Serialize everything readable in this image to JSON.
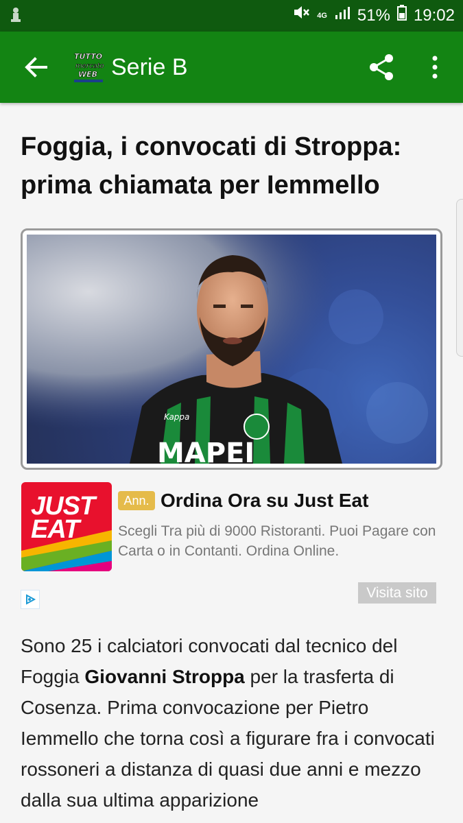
{
  "status_bar": {
    "network": "4G",
    "battery": "51%",
    "time": "19:02"
  },
  "app_bar": {
    "logo_text": [
      "TUTTO",
      "mercato",
      "WEB"
    ],
    "title": "Serie B"
  },
  "article": {
    "headline": "Foggia, i convocati di Stroppa: prima chiamata per Iemmello",
    "body": [
      {
        "text": "Sono 25 i calciatori convocati dal tecnico del Foggia ",
        "bold": false
      },
      {
        "text": "Giovanni Stroppa",
        "bold": true
      },
      {
        "text": " per la trasferta di Cosenza. Prima convocazione per Pietro Iemmello che torna così a figurare fra i convocati rossoneri a distanza di quasi due anni e mezzo dalla sua ultima apparizione",
        "bold": false
      }
    ],
    "photo": {
      "sponsor_text": "MAPEI",
      "kit_brand": "Kappa"
    }
  },
  "ad": {
    "logo_lines": [
      "JUST",
      "EAT"
    ],
    "tag": "Ann.",
    "title": "Ordina Ora su Just Eat",
    "description": "Scegli Tra più di 9000 Ristoranti. Puoi Pagare con Carta o in Contanti. Ordina Online.",
    "cta": "Visita sito"
  },
  "colors": {
    "status_bar": "#0f5a0f",
    "app_bar": "#138413",
    "ad_brand": "#e8112d",
    "ad_tag": "#e5bb4a"
  },
  "icons": {
    "back": "arrow-left-icon",
    "share": "share-icon",
    "menu": "more-vert-icon",
    "ad_choice": "adchoices-icon"
  }
}
